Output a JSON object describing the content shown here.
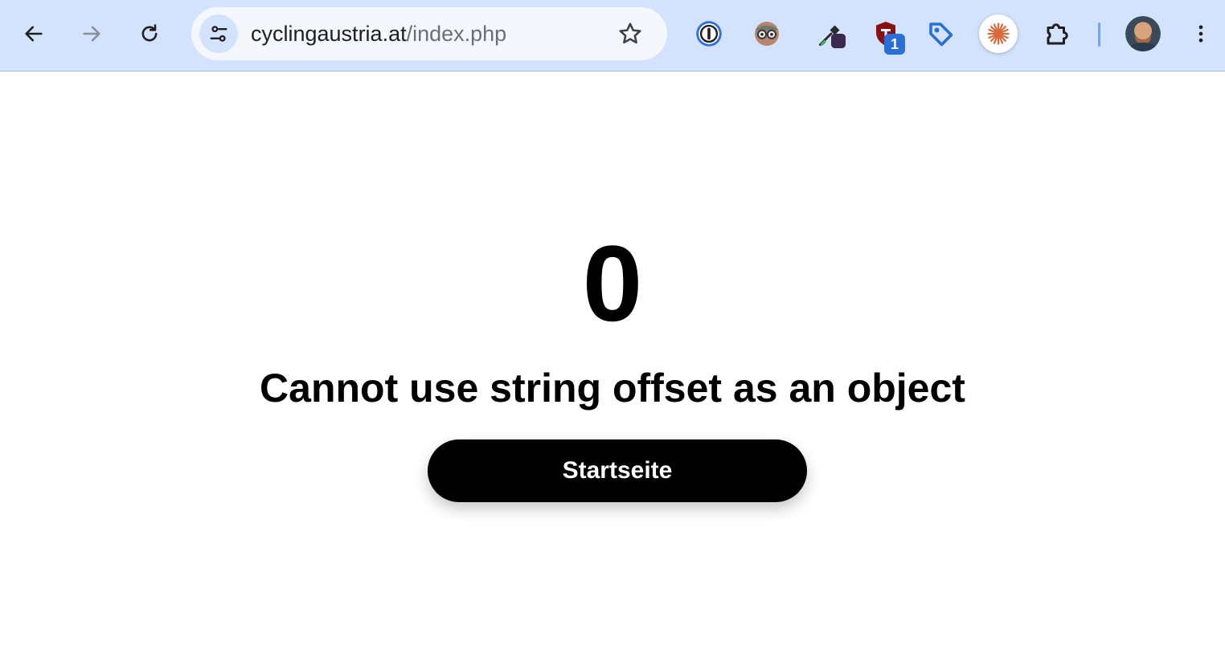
{
  "browser": {
    "url_host": "cyclingaustria.at",
    "url_path": "/index.php",
    "icons": {
      "back": "arrow-left-icon",
      "forward": "arrow-right-icon",
      "reload": "reload-icon",
      "site_info": "tune-icon",
      "bookmark": "star-icon",
      "menu": "kebab-menu-icon"
    },
    "extensions": [
      {
        "name": "1password-icon"
      },
      {
        "name": "glasses-face-icon"
      },
      {
        "name": "eyedropper-icon"
      },
      {
        "name": "shield-icon",
        "badge": "1"
      },
      {
        "name": "tag-icon"
      },
      {
        "name": "sparkle-icon"
      },
      {
        "name": "puzzle-icon"
      }
    ],
    "colors": {
      "toolbar": "#d3e3fd",
      "omnibox": "#f4f7fc",
      "badge": "#2a6fd8"
    }
  },
  "page": {
    "error_code": "0",
    "error_message": "Cannot use string offset as an object",
    "home_button_label": "Startseite"
  }
}
